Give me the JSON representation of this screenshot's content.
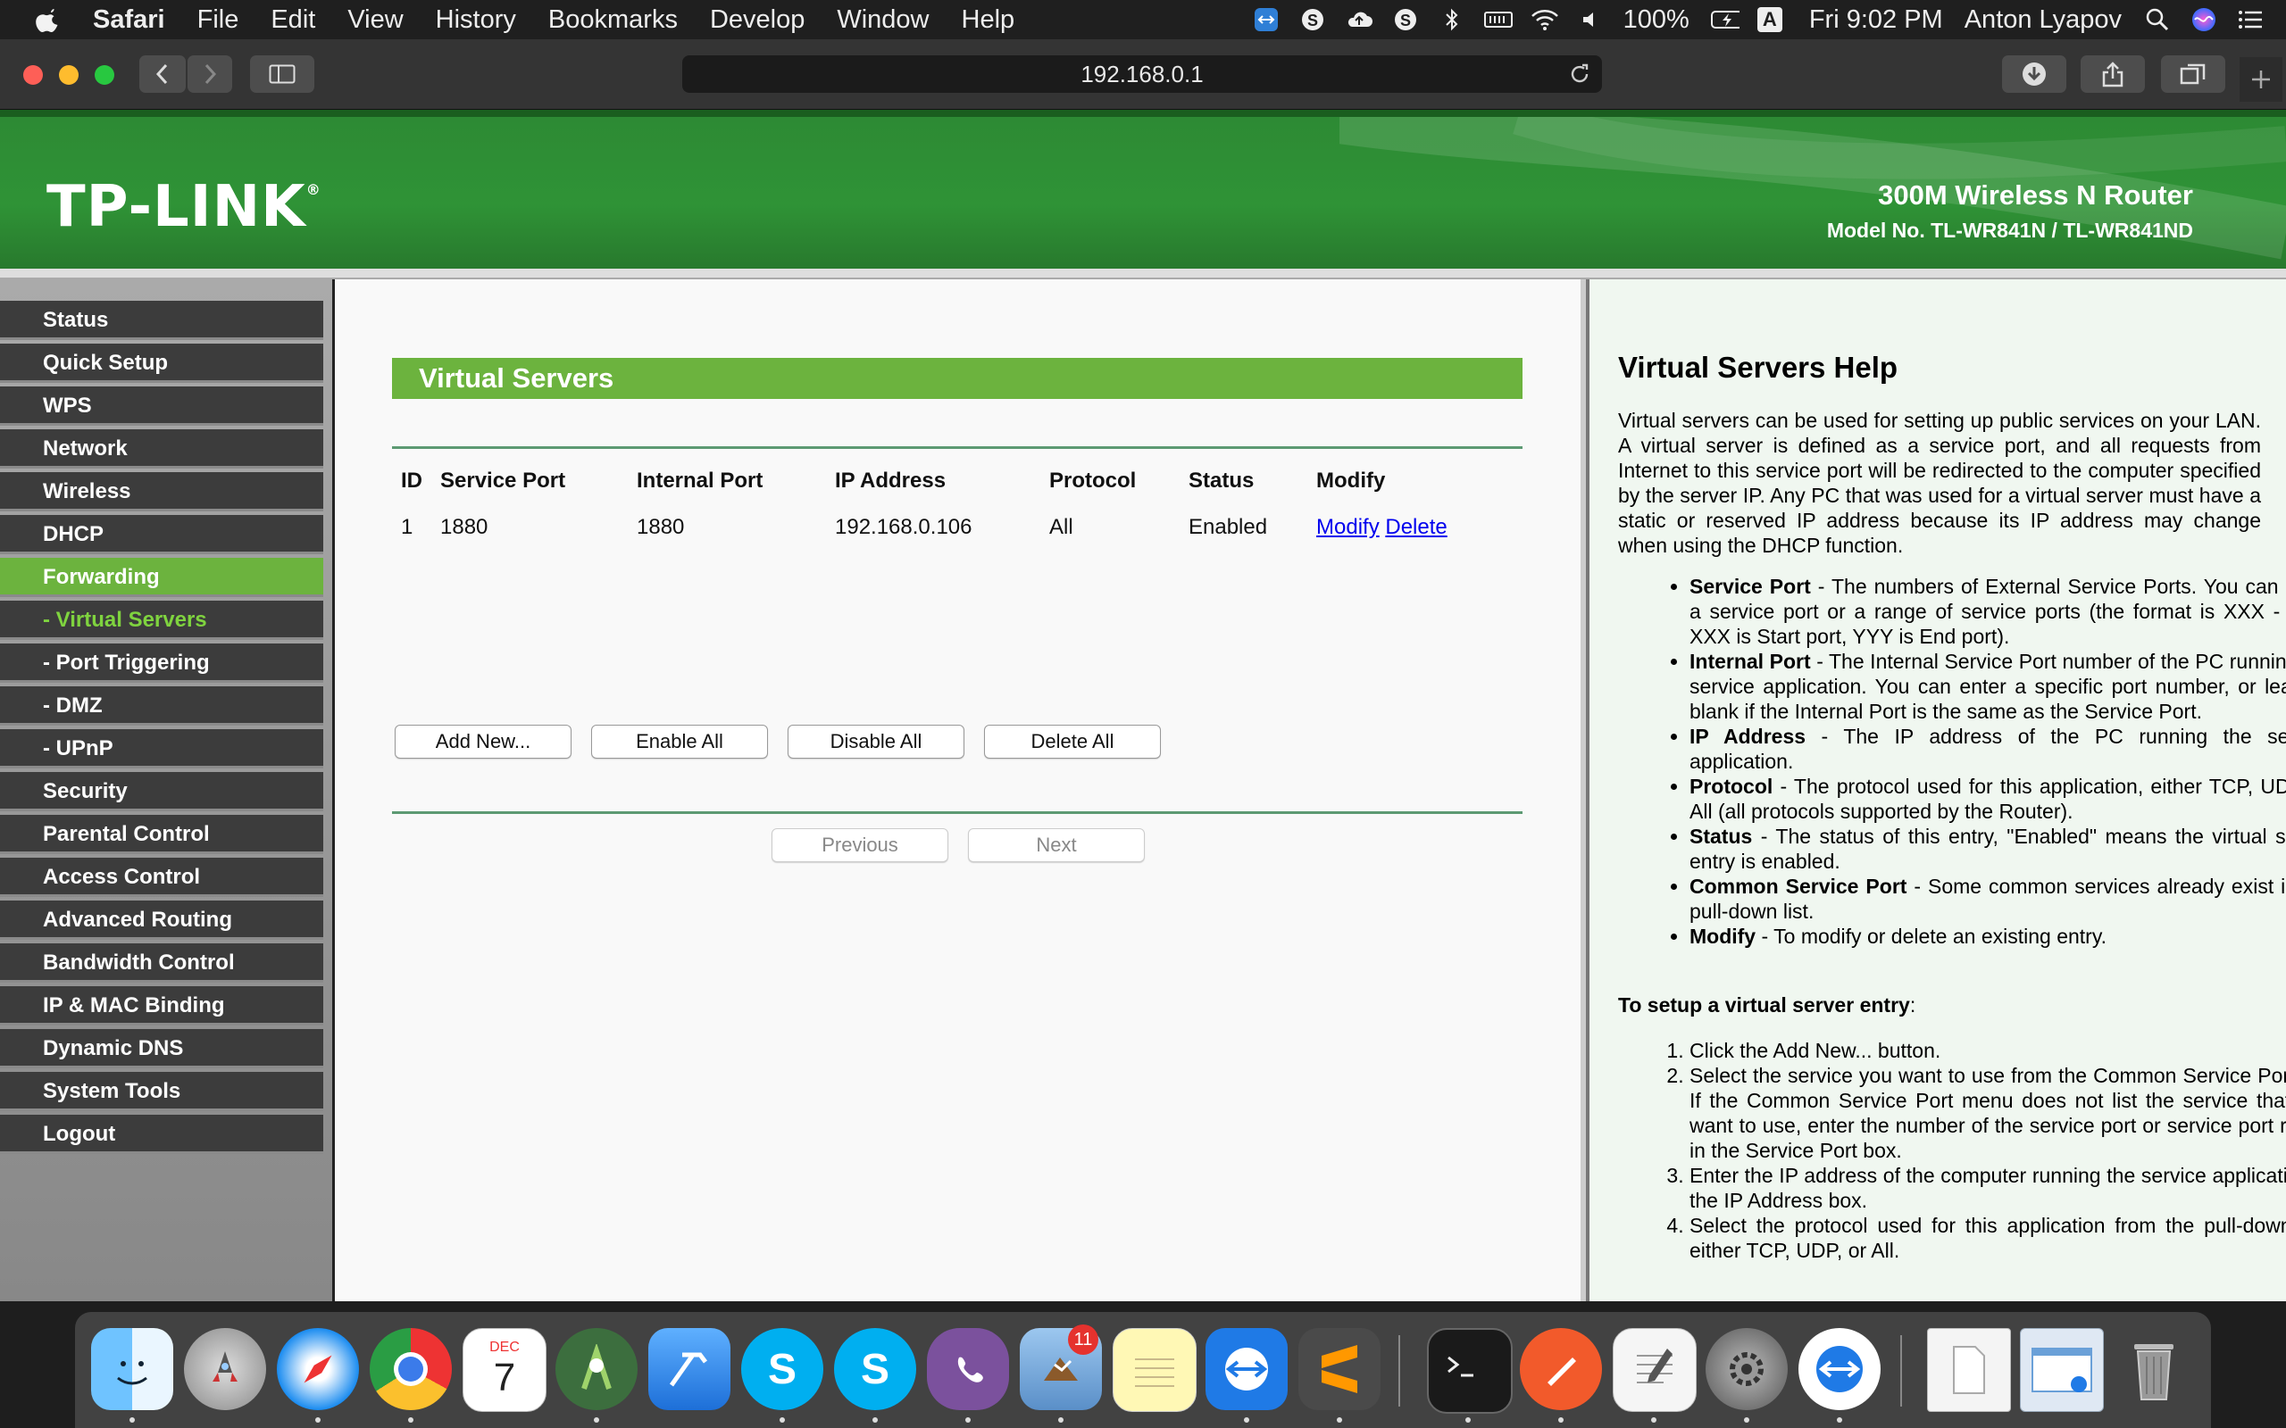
{
  "menubar": {
    "app_name": "Safari",
    "items": [
      "File",
      "Edit",
      "View",
      "History",
      "Bookmarks",
      "Develop",
      "Window",
      "Help"
    ],
    "battery": "100%",
    "input_source": "A",
    "clock": "Fri 9:02 PM",
    "user": "Anton Lyapov"
  },
  "browser": {
    "url": "192.168.0.1"
  },
  "router": {
    "logo": "TP-LINK",
    "logo_mark": "®",
    "product": "300M Wireless N Router",
    "model": "Model No. TL-WR841N / TL-WR841ND"
  },
  "nav": {
    "items": [
      "Status",
      "Quick Setup",
      "WPS",
      "Network",
      "Wireless",
      "DHCP",
      "Forwarding",
      "- Virtual Servers",
      "- Port Triggering",
      "- DMZ",
      "- UPnP",
      "Security",
      "Parental Control",
      "Access Control",
      "Advanced Routing",
      "Bandwidth Control",
      "IP & MAC Binding",
      "Dynamic DNS",
      "System Tools",
      "Logout"
    ],
    "active": "Forwarding",
    "active_sub": "- Virtual Servers"
  },
  "main": {
    "title": "Virtual Servers",
    "table": {
      "headers": [
        "ID",
        "Service Port",
        "Internal Port",
        "IP Address",
        "Protocol",
        "Status",
        "Modify"
      ],
      "rows": [
        {
          "id": "1",
          "service_port": "1880",
          "internal_port": "1880",
          "ip": "192.168.0.106",
          "protocol": "All",
          "status": "Enabled",
          "modify": "Modify",
          "delete": "Delete"
        }
      ]
    },
    "buttons": {
      "add_new": "Add New...",
      "enable_all": "Enable All",
      "disable_all": "Disable All",
      "delete_all": "Delete All",
      "previous": "Previous",
      "next": "Next"
    }
  },
  "help": {
    "title": "Virtual Servers Help",
    "intro": "Virtual servers can be used for setting up public services on your LAN. A virtual server is defined as a service port, and all requests from Internet to this service port will be redirected to the computer specified by the server IP. Any PC that was used for a virtual server must have a static or reserved IP address because its IP address may change when using the DHCP function.",
    "bullets": [
      {
        "term": "Service Port",
        "text": " - The numbers of External Service Ports. You can enter a service port or a range of service ports (the format is XXX - YYY, XXX is Start port, YYY is End port)."
      },
      {
        "term": "Internal Port",
        "text": " - The Internal Service Port number of the PC running the service application. You can enter a specific port number, or leave it blank if the Internal Port is the same as the Service Port."
      },
      {
        "term": "IP Address",
        "text": " - The IP address of the PC running the service application."
      },
      {
        "term": "Protocol",
        "text": " - The protocol used for this application, either TCP, UDP, or All (all protocols supported by the Router)."
      },
      {
        "term": "Status",
        "text": " - The status of this entry, \"Enabled\" means the virtual server entry is enabled."
      },
      {
        "term": "Common Service Port",
        "text": " - Some common services already exist in the pull-down list."
      },
      {
        "term": "Modify",
        "text": " - To modify or delete an existing entry."
      }
    ],
    "steps_title": "To setup a virtual server entry",
    "steps_title_suffix": ":",
    "steps": [
      "Click the Add New... button.",
      "Select the service you want to use from the Common Service Port list. If the Common Service Port menu does not list the service that you want to use, enter the number of the service port or service port range in the Service Port box.",
      "Enter the IP address of the computer running the service application in the IP Address box.",
      "Select the protocol used for this application from the pull-down list, either TCP, UDP, or All."
    ]
  },
  "dock": {
    "calendar_month": "DEC",
    "calendar_day": "7",
    "mail_badge": "11",
    "apps": [
      "finder-icon",
      "launchpad-icon",
      "safari-icon",
      "chrome-icon",
      "calendar-icon",
      "android-studio-icon",
      "xcode-icon",
      "skype-icon",
      "skype-for-business-icon",
      "viber-icon",
      "mail-icon",
      "notes-icon",
      "teamviewer-icon",
      "sublime-text-icon",
      "terminal-icon",
      "sketch-icon",
      "textedit-icon",
      "system-preferences-icon",
      "teamviewer-quicksupport-icon",
      "document-icon",
      "screenshot-folder-icon",
      "trash-icon"
    ]
  }
}
